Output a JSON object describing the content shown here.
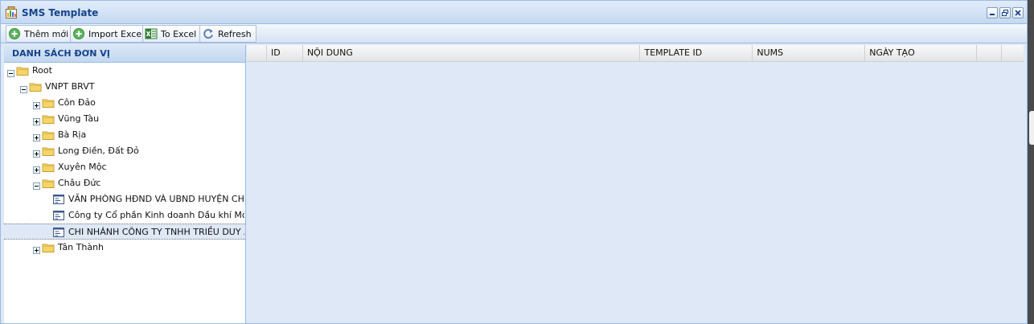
{
  "window": {
    "title": "SMS Template",
    "title_icon": "report-icon"
  },
  "window_controls": [
    {
      "name": "minimize-icon"
    },
    {
      "name": "restore-icon"
    },
    {
      "name": "close-icon"
    }
  ],
  "toolbar": {
    "buttons": [
      {
        "label": "Thêm mới",
        "icon": "add-icon"
      },
      {
        "label": "Import Excel",
        "icon": "import-icon"
      },
      {
        "label": "To Excel",
        "icon": "excel-icon"
      },
      {
        "label": "Refresh",
        "icon": "refresh-icon"
      }
    ]
  },
  "tree_panel": {
    "title": "DANH SÁCH ĐƠN VỊ",
    "nodes": [
      {
        "label": "Root",
        "level": 0,
        "type": "folder",
        "expanded": true
      },
      {
        "label": "VNPT BRVT",
        "level": 1,
        "type": "folder",
        "expanded": true
      },
      {
        "label": "Côn Đảo",
        "level": 2,
        "type": "folder",
        "expanded": false
      },
      {
        "label": "Vũng Tàu",
        "level": 2,
        "type": "folder",
        "expanded": false
      },
      {
        "label": "Bà Rịa",
        "level": 2,
        "type": "folder",
        "expanded": false
      },
      {
        "label": "Long Điền, Đất Đỏ",
        "level": 2,
        "type": "folder",
        "expanded": false
      },
      {
        "label": "Xuyên Mộc",
        "level": 2,
        "type": "folder",
        "expanded": false
      },
      {
        "label": "Châu Đức",
        "level": 2,
        "type": "folder",
        "expanded": true
      },
      {
        "label": "VĂN PHÒNG HĐND VÀ UBND HUYỆN CHÂU",
        "level": 3,
        "type": "leaf"
      },
      {
        "label": "Công ty Cổ phần Kinh doanh Dầu khí Mỏ hóa",
        "level": 3,
        "type": "leaf"
      },
      {
        "label": "CHI NHÁNH CÔNG TY TNHH TRIỀU DUY AN",
        "level": 3,
        "type": "leaf",
        "selected": true
      },
      {
        "label": "Tân Thành",
        "level": 2,
        "type": "folder",
        "expanded": false
      }
    ]
  },
  "grid": {
    "columns": [
      "ID",
      "NỘI DUNG",
      "TEMPLATE ID",
      "NUMS",
      "NGÀY TẠO",
      "",
      ""
    ]
  }
}
